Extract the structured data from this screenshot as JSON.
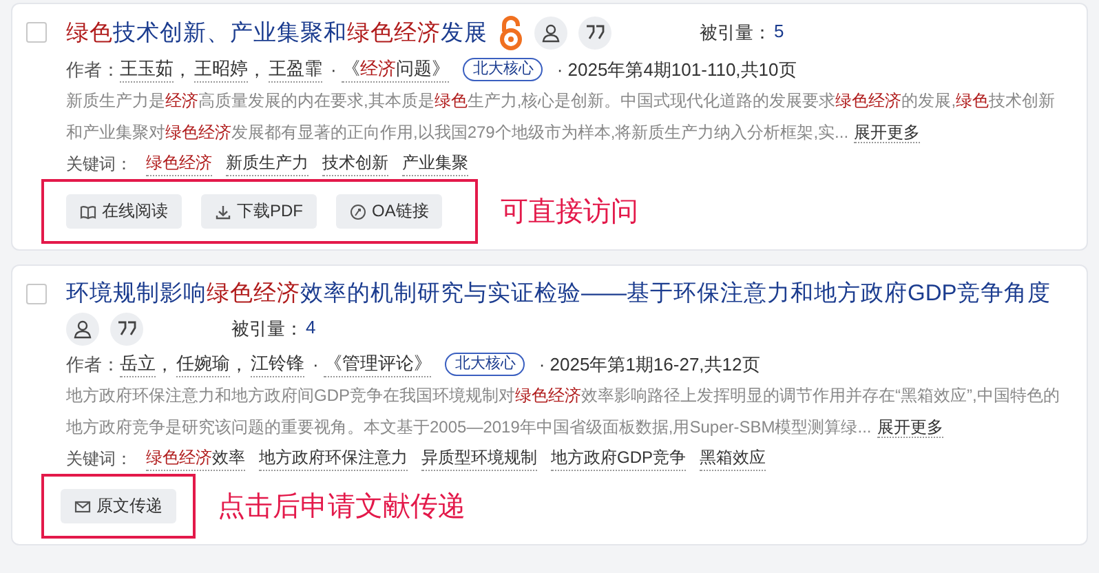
{
  "articles": [
    {
      "title": "**绿色**技术创新、产业集聚和**绿色经济**发展",
      "selected": false,
      "open_access": true,
      "cite_label": "被引量：",
      "cite_count": "5",
      "author_label": "作者：",
      "authors": [
        {
          "name": "王玉茹",
          "sep": "，"
        },
        {
          "name": "王昭婷",
          "sep": "，"
        },
        {
          "name": "王盈霏"
        }
      ],
      "journal_prefix": "·",
      "journal": "《**经济**问题》",
      "badge": "北大核心",
      "issue": "· 2025年第4期101-110,共10页",
      "abstract": "新质生产力是**经济**高质量发展的内在要求,其本质是**绿色**生产力,核心是创新。中国式现代化道路的发展要求**绿色经济**的发展,**绿色**技术创新和产业集聚对**绿色经济**发展都有显著的正向作用,以我国279个地级市为样本,将新质生产力纳入分析框架,实...",
      "more": "展开更多",
      "keyword_label": "关键词：",
      "keywords": [
        "**绿色经济**",
        "新质生产力",
        "技术创新",
        "产业集聚"
      ],
      "buttons": [
        {
          "kind": "read",
          "label": "在线阅读"
        },
        {
          "kind": "pdf",
          "label": "下载PDF"
        },
        {
          "kind": "oa",
          "label": "OA链接"
        }
      ],
      "annotation": "可直接访问"
    },
    {
      "title": "环境规制影响**绿色经济**效率的机制研究与实证检验——基于环保注意力和地方政府GDP竞争角度",
      "selected": false,
      "open_access": false,
      "cite_label": "被引量：",
      "cite_count": "4",
      "author_label": "作者：",
      "authors": [
        {
          "name": "岳立",
          "sep": "，"
        },
        {
          "name": "任婉瑜",
          "sep": "，"
        },
        {
          "name": "江铃锋"
        }
      ],
      "journal_prefix": "·",
      "journal": "《管理评论》",
      "badge": "北大核心",
      "issue": "· 2025年第1期16-27,共12页",
      "abstract": "地方政府环保注意力和地方政府间GDP竞争在我国环境规制对**绿色经济**效率影响路径上发挥明显的调节作用并存在“黑箱效应”,中国特色的地方政府竞争是研究该问题的重要视角。本文基于2005—2019年中国省级面板数据,用Super-SBM模型测算绿...",
      "more": "展开更多",
      "keyword_label": "关键词：",
      "keywords": [
        "**绿色经济**效率",
        "地方政府环保注意力",
        "异质型环境规制",
        "地方政府GDP竞争",
        "黑箱效应"
      ],
      "buttons": [
        {
          "kind": "mail",
          "label": "原文传递"
        }
      ],
      "annotation": "点击后申请文献传递"
    }
  ]
}
